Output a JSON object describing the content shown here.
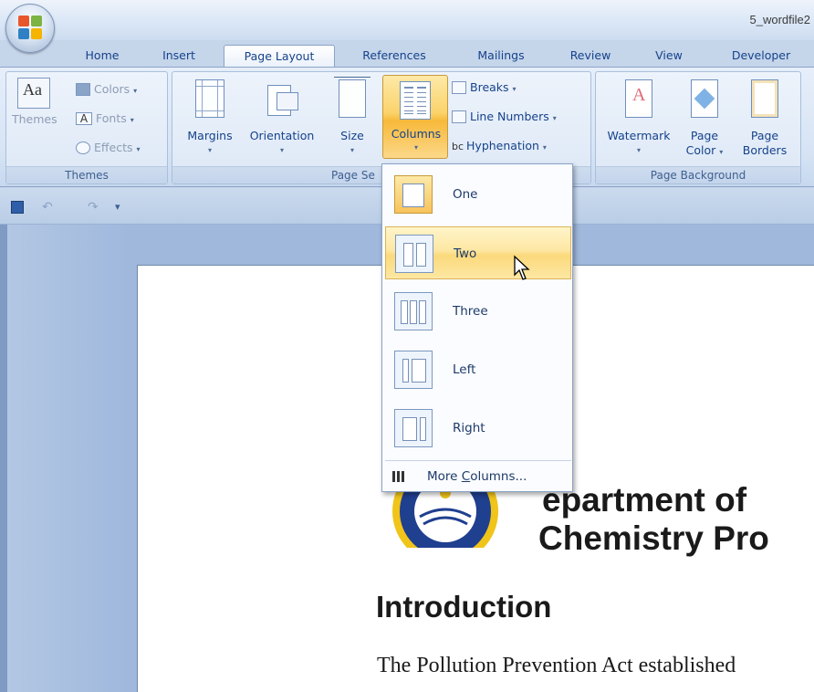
{
  "window": {
    "title": "5_wordfile2"
  },
  "tabs": [
    "Home",
    "Insert",
    "Page Layout",
    "References",
    "Mailings",
    "Review",
    "View",
    "Developer"
  ],
  "active_tab": "Page Layout",
  "ribbon": {
    "themes": {
      "big_label": "Themes",
      "colors": "Colors",
      "fonts": "Fonts",
      "effects": "Effects",
      "group_label": "Themes"
    },
    "page_setup": {
      "margins": "Margins",
      "orientation": "Orientation",
      "size": "Size",
      "columns": "Columns",
      "breaks": "Breaks",
      "line_numbers": "Line Numbers",
      "hyphenation": "Hyphenation",
      "group_label": "Page Se"
    },
    "page_background": {
      "watermark": "Watermark",
      "page_color_1": "Page",
      "page_color_2": "Color",
      "page_borders_1": "Page",
      "page_borders_2": "Borders",
      "group_label": "Page Background"
    }
  },
  "columns_menu": {
    "items": [
      "One",
      "Two",
      "Three",
      "Left",
      "Right"
    ],
    "selected": "One",
    "hovered": "Two",
    "more_prefix": "More ",
    "more_underlined": "C",
    "more_suffix": "olumns..."
  },
  "document": {
    "heading_line1": "epartment of",
    "heading_line2": "Chemistry Pro",
    "section_heading": "Introduction",
    "body_start": "The Pollution Prevention Act established"
  },
  "colors": {
    "accent": "#fbd36b",
    "tab_text": "#15428b",
    "ribbon_bg": "#d7e4f5",
    "workspace": "#9fb8dc"
  }
}
